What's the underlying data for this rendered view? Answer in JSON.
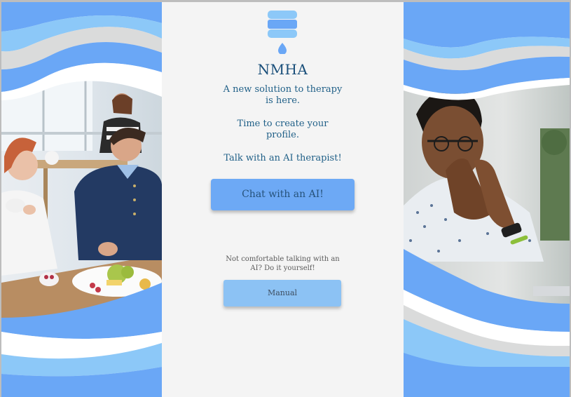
{
  "brand": {
    "name": "NMHA",
    "logo_icon": "stacked-water-drop-icon"
  },
  "tagline": [
    [
      "A new solution to therapy",
      "is here."
    ],
    [
      "Time to create your",
      "profile."
    ],
    [
      "Talk with an AI therapist!"
    ]
  ],
  "actions": {
    "chat_ai_label": "Chat with an AI!",
    "manual_prompt": [
      "Not comfortable talking with an",
      "AI? Do it yourself!"
    ],
    "manual_label": "Manual"
  },
  "images": {
    "left": "people-dining-photo",
    "right": "thoughtful-man-photo"
  },
  "colors": {
    "accent": "#6da9f5",
    "light_accent": "#8cc2f4",
    "title": "#1a4f7a",
    "wave_dark": "#6aa7f6",
    "wave_light": "#8cc8f8"
  }
}
